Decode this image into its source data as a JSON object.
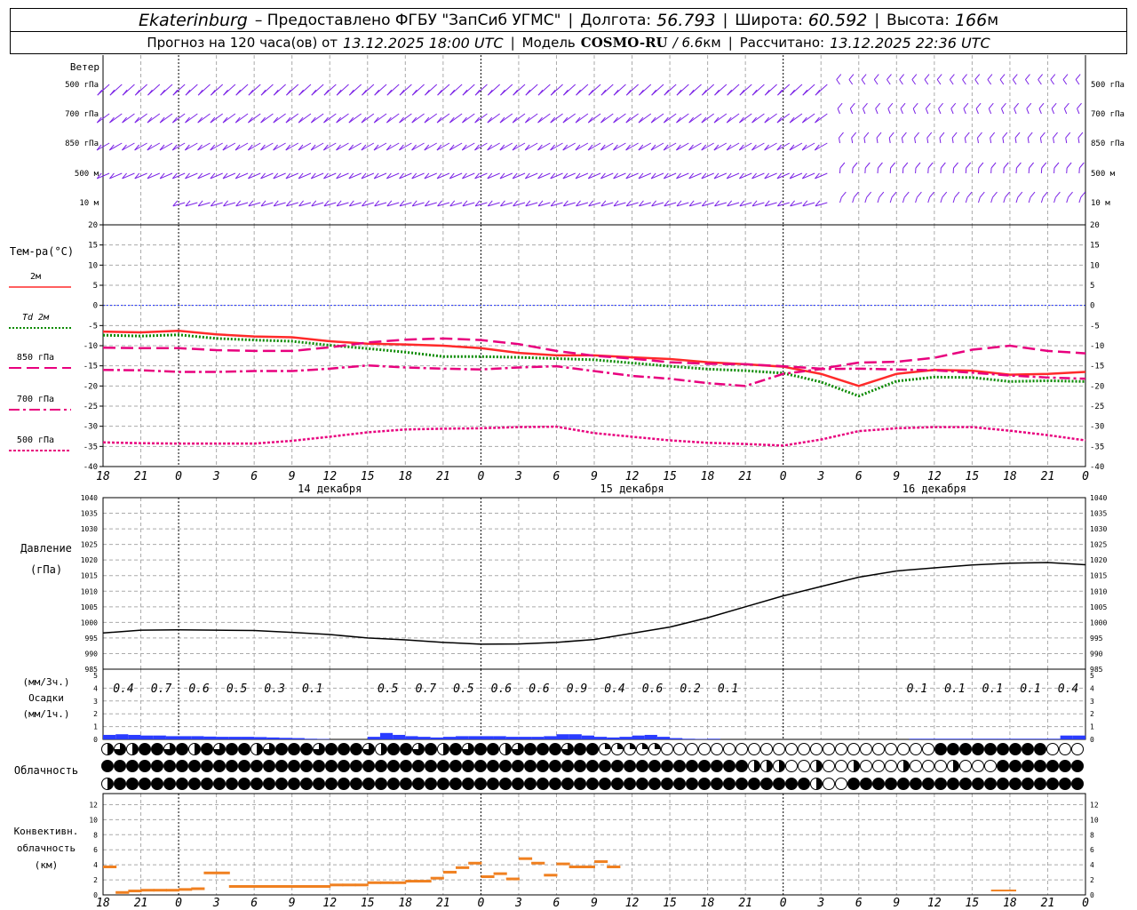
{
  "header": {
    "city": "Ekaterinburg",
    "provider": "– Предоставлено ФГБУ \"ЗапСиб УГМС\"",
    "lon_label": "Долгота:",
    "lon_value": "56.793",
    "lat_label": "Широта:",
    "lat_value": "60.592",
    "alt_label": "Высота:",
    "alt_value": "166",
    "alt_unit": "м",
    "forecast_prefix": "Прогноз на 120 часа(ов) от",
    "forecast_start": "13.12.2025 18:00 UTC",
    "model_label": "Модель",
    "model_name": "COSMO-RU",
    "model_res": "/ 6.6",
    "model_res_unit": "км",
    "calc_label": "Рассчитано:",
    "calc_time": "13.12.2025 22:36 UTC"
  },
  "colors": {
    "wind": "#7a22e6",
    "t2m": "#ff2a2a",
    "td": "#0a8a00",
    "t850": "#e8007e",
    "t700": "#e8007e",
    "t500": "#e8007e",
    "zero": "#2233ff",
    "precip": "#2a3cff",
    "conv": "#f08020",
    "grid": "#aaaaaa"
  },
  "time_axis": {
    "hours": [
      "18",
      "21",
      "0",
      "3",
      "6",
      "9",
      "12",
      "15",
      "18",
      "21",
      "0",
      "3",
      "6",
      "9",
      "12",
      "15",
      "18",
      "21",
      "0",
      "3",
      "6",
      "9",
      "12",
      "15",
      "18",
      "21",
      "0"
    ],
    "days": [
      "14 декабря",
      "15 декабря",
      "16 декабря"
    ]
  },
  "wind_panel": {
    "title": "Ветер",
    "levels": [
      "500 гПа",
      "700 гПа",
      "850 гПа",
      "500 м",
      "10  м"
    ]
  },
  "temp_panel": {
    "title": "Тем-ра(°С)",
    "legend": [
      {
        "label": "2м",
        "style": "solid"
      },
      {
        "label": "Td  2м",
        "style": "dotted"
      },
      {
        "label": "850 гПа",
        "style": "longdash"
      },
      {
        "label": "700 гПа",
        "style": "dashdot"
      },
      {
        "label": "500 гПа",
        "style": "dashed"
      }
    ]
  },
  "pressure_panel": {
    "title": "Давление",
    "unit": "(гПа)"
  },
  "precip_panel": {
    "label1": "(мм/3ч.)",
    "label2": "Осадки",
    "label3": "(мм/1ч.)",
    "totals": [
      "0.4",
      "0.7",
      "0.6",
      "0.5",
      "0.3",
      "0.1",
      "",
      "0.5",
      "0.7",
      "0.5",
      "0.6",
      "0.6",
      "0.9",
      "0.4",
      "0.6",
      "0.2",
      "0.1",
      "",
      "",
      "",
      "",
      "0.1",
      "0.1",
      "0.1",
      "0.1",
      "0.4"
    ]
  },
  "cloud_panel": {
    "title": "Облачность"
  },
  "conv_panel": {
    "title1": "Конвективн.",
    "title2": "облачность",
    "title3": "(км)"
  },
  "chart_data": [
    {
      "type": "line",
      "title": "Тем-ра(°С)",
      "x_hours": [
        0,
        3,
        6,
        9,
        12,
        15,
        18,
        21,
        24,
        27,
        30,
        33,
        36,
        39,
        42,
        45,
        48,
        51,
        54,
        57,
        60,
        63,
        66,
        69,
        72,
        75,
        78
      ],
      "ylim": [
        -40,
        20
      ],
      "yticks": [
        -40,
        -35,
        -30,
        -25,
        -20,
        -15,
        -10,
        -5,
        0,
        5,
        10,
        15,
        20
      ],
      "series": [
        {
          "name": "2м",
          "values": [
            -6.5,
            -6.7,
            -6.3,
            -7.2,
            -7.7,
            -7.9,
            -8.9,
            -9.5,
            -9.7,
            -10.0,
            -10.6,
            -11.8,
            -12.4,
            -12.4,
            -12.9,
            -13.3,
            -14.1,
            -14.6,
            -15.2,
            -17.0,
            -20.0,
            -17.0,
            -16.0,
            -16.2,
            -17.2,
            -17.0,
            -16.5
          ]
        },
        {
          "name": "Td  2м",
          "values": [
            -7.4,
            -7.6,
            -7.3,
            -8.2,
            -8.6,
            -8.9,
            -9.9,
            -10.7,
            -11.6,
            -12.7,
            -12.7,
            -12.9,
            -13.2,
            -13.5,
            -14.3,
            -15.1,
            -15.8,
            -16.2,
            -16.8,
            -19.0,
            -22.5,
            -18.8,
            -17.8,
            -17.9,
            -18.9,
            -18.7,
            -18.9
          ]
        },
        {
          "name": "850 гПа",
          "values": [
            -10.5,
            -10.6,
            -10.6,
            -11.1,
            -11.3,
            -11.3,
            -10.4,
            -9.2,
            -8.5,
            -8.2,
            -8.6,
            -9.6,
            -11.3,
            -12.5,
            -13.2,
            -14.1,
            -14.5,
            -14.6,
            -15.1,
            -15.7,
            -14.2,
            -14.0,
            -13.0,
            -11.0,
            -10.0,
            -11.3,
            -11.9
          ]
        },
        {
          "name": "700 гПа",
          "values": [
            -16.0,
            -16.1,
            -16.5,
            -16.5,
            -16.3,
            -16.3,
            -15.7,
            -14.9,
            -15.4,
            -15.7,
            -15.9,
            -15.4,
            -15.1,
            -16.3,
            -17.5,
            -18.2,
            -19.3,
            -20.0,
            -17.0,
            -15.8,
            -15.7,
            -15.9,
            -16.1,
            -16.7,
            -17.4,
            -17.9,
            -18.2
          ]
        },
        {
          "name": "500 гПа",
          "values": [
            -34,
            -34.2,
            -34.3,
            -34.3,
            -34.3,
            -33.6,
            -32.6,
            -31.5,
            -30.8,
            -30.6,
            -30.5,
            -30.2,
            -30.1,
            -31.7,
            -32.6,
            -33.5,
            -34.1,
            -34.4,
            -34.8,
            -33.3,
            -31.2,
            -30.5,
            -30.2,
            -30.2,
            -31.1,
            -32.2,
            -33.5
          ]
        }
      ]
    },
    {
      "type": "line",
      "title": "Давление",
      "ylabel": "(гПа)",
      "x_hours": [
        0,
        3,
        6,
        9,
        12,
        15,
        18,
        21,
        24,
        27,
        30,
        33,
        36,
        39,
        42,
        45,
        48,
        51,
        54,
        57,
        60,
        63,
        66,
        69,
        72,
        75,
        78
      ],
      "ylim": [
        985,
        1040
      ],
      "yticks": [
        985,
        990,
        995,
        1000,
        1005,
        1010,
        1015,
        1020,
        1025,
        1030,
        1035,
        1040
      ],
      "series": [
        {
          "name": "",
          "values": [
            996.6,
            997.5,
            997.6,
            997.5,
            997.4,
            996.8,
            996.1,
            995.0,
            994.4,
            993.6,
            993.0,
            993.1,
            993.6,
            994.5,
            996.5,
            998.5,
            1001.5,
            1005.0,
            1008.5,
            1011.5,
            1014.5,
            1016.5,
            1017.5,
            1018.4,
            1019.0,
            1019.2,
            1018.5
          ]
        }
      ]
    },
    {
      "type": "bar",
      "title": "Осадки",
      "ylabel": "(мм/1ч.)",
      "ylim": [
        0,
        5
      ],
      "x_hours": [
        1,
        2,
        3,
        4,
        5,
        6,
        7,
        8,
        9,
        10,
        11,
        12,
        13,
        14,
        15,
        16,
        17,
        18,
        19,
        20,
        21,
        22,
        23,
        24,
        25,
        26,
        27,
        28,
        29,
        30,
        31,
        32,
        33,
        34,
        35,
        36,
        37,
        38,
        39,
        40,
        41,
        42,
        43,
        44,
        45,
        46,
        47,
        48,
        49,
        50,
        51,
        52,
        53,
        54,
        55,
        56,
        57,
        58,
        59,
        60,
        61,
        62,
        63,
        64,
        65,
        66,
        67,
        68,
        69,
        70,
        71,
        72,
        73,
        74,
        75,
        76,
        77,
        78
      ],
      "values": [
        0.35,
        0.4,
        0.35,
        0.3,
        0.3,
        0.25,
        0.25,
        0.25,
        0.22,
        0.2,
        0.2,
        0.2,
        0.18,
        0.15,
        0.12,
        0.1,
        0.05,
        0.03,
        0.0,
        0.0,
        0.0,
        0.2,
        0.5,
        0.35,
        0.25,
        0.2,
        0.15,
        0.2,
        0.25,
        0.25,
        0.25,
        0.25,
        0.2,
        0.2,
        0.2,
        0.25,
        0.4,
        0.4,
        0.3,
        0.2,
        0.15,
        0.2,
        0.3,
        0.35,
        0.2,
        0.1,
        0.05,
        0.03,
        0.05,
        0.0,
        0.0,
        0.0,
        0.0,
        0.0,
        0.0,
        0.0,
        0.0,
        0.0,
        0.0,
        0.0,
        0.0,
        0.0,
        0.0,
        0.0,
        0.05,
        0.05,
        0.05,
        0.05,
        0.05,
        0.05,
        0.05,
        0.05,
        0.05,
        0.05,
        0.05,
        0.05,
        0.3,
        0.3
      ]
    },
    {
      "type": "bar",
      "title": "Конвективн. облачность",
      "ylabel": "(км)",
      "ylim": [
        0,
        13
      ],
      "yticks": [
        0,
        2,
        4,
        6,
        8,
        10,
        12
      ],
      "x_hours": [
        0,
        1,
        2,
        3,
        4,
        5,
        6,
        7,
        8,
        9,
        10,
        11,
        12,
        13,
        14,
        15,
        16,
        17,
        18,
        19,
        20,
        21,
        22,
        23,
        24,
        25,
        26,
        27,
        28,
        29,
        30,
        31,
        32,
        33,
        34,
        35,
        36,
        37,
        38,
        39,
        40,
        41,
        42,
        43,
        44,
        45,
        46,
        47,
        48,
        49,
        50,
        51,
        52,
        53,
        54,
        55,
        56,
        57,
        58,
        59,
        60,
        61,
        62,
        63,
        64,
        65,
        66,
        67,
        68,
        69,
        70,
        71,
        72,
        73,
        74,
        75,
        76,
        77,
        78
      ],
      "tops": [
        3.9,
        0.5,
        0.7,
        0.8,
        0.8,
        0.8,
        0.9,
        1.0,
        3.1,
        3.1,
        1.3,
        1.3,
        1.3,
        1.3,
        1.3,
        1.3,
        1.3,
        1.3,
        1.5,
        1.5,
        1.5,
        1.8,
        1.8,
        1.8,
        2.0,
        2.0,
        2.4,
        3.2,
        3.8,
        4.4,
        2.6,
        3.0,
        2.3,
        5.0,
        4.4,
        2.8,
        4.3,
        3.9,
        3.9,
        4.6,
        3.9,
        0,
        0,
        0,
        0,
        0,
        0,
        0,
        0,
        0,
        0,
        0,
        0,
        0,
        0,
        0,
        0,
        0,
        0,
        0,
        0,
        0,
        0,
        0,
        0,
        0,
        0,
        0,
        0,
        0,
        0,
        0,
        0,
        0,
        0,
        0,
        0,
        0,
        0
      ],
      "bottoms": [
        3.6,
        0.3,
        0.5,
        0.6,
        0.6,
        0.6,
        0.7,
        0.8,
        2.8,
        2.8,
        1.1,
        1.1,
        1.1,
        1.1,
        1.1,
        1.1,
        1.1,
        1.1,
        1.3,
        1.3,
        1.3,
        1.6,
        1.6,
        1.6,
        1.8,
        1.8,
        2.1,
        2.9,
        3.5,
        4.1,
        2.3,
        2.7,
        2.0,
        4.7,
        4.1,
        2.5,
        4.0,
        3.6,
        3.6,
        4.3,
        3.6,
        0,
        0,
        0,
        0,
        0,
        0,
        0,
        0,
        0,
        0,
        0,
        0,
        0,
        0,
        0,
        0,
        0,
        0,
        0,
        0,
        0,
        0,
        0,
        0,
        0,
        0,
        0,
        0,
        0,
        0,
        0,
        0,
        0,
        0,
        0,
        0,
        0,
        0
      ]
    }
  ]
}
